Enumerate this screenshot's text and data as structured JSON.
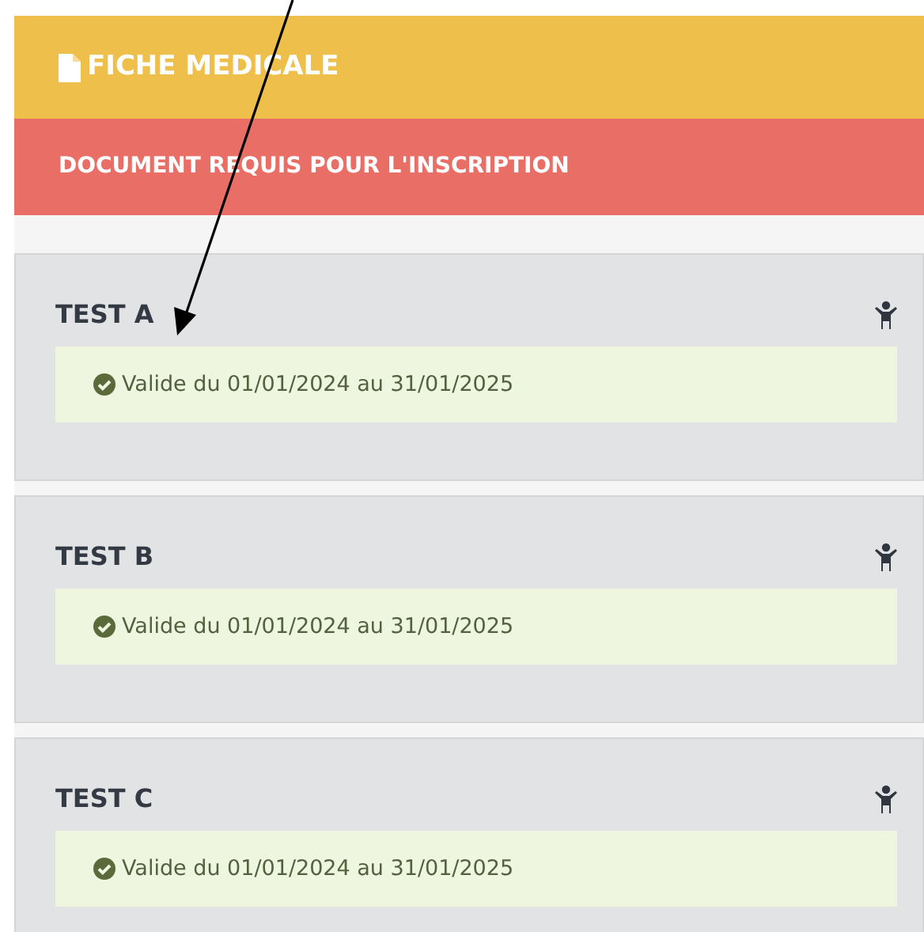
{
  "header": {
    "title": "FICHE MEDICALE"
  },
  "notice": {
    "text": "DOCUMENT REQUIS POUR L'INSCRIPTION"
  },
  "tests": [
    {
      "name": "TEST A",
      "valid": true,
      "validity": "Valide du 01/01/2024 au 31/01/2025"
    },
    {
      "name": "TEST B",
      "valid": true,
      "validity": "Valide du 01/01/2024 au 31/01/2025"
    },
    {
      "name": "TEST C",
      "valid": true,
      "validity": "Valide du 01/01/2024 au 31/01/2025"
    }
  ]
}
